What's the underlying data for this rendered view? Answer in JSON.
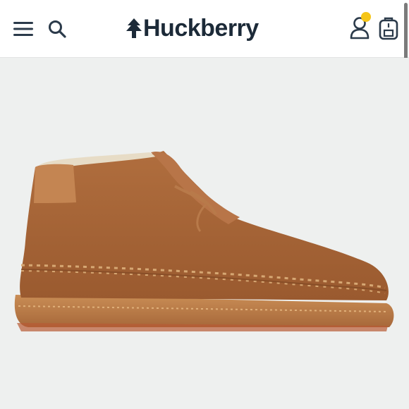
{
  "header": {
    "logo_text": "Huckberry",
    "menu_icon": "hamburger-menu-icon",
    "search_icon": "search-icon",
    "account_icon": "account-icon",
    "cart_icon": "backpack-cart-icon",
    "notification_badge_color": "#f5c518"
  },
  "product": {
    "image_subject": "suede-chukka-sneaker-boot",
    "background_color": "#eef0ef",
    "primary_color": "#a5663a"
  },
  "colors": {
    "brand_text": "#1c2a38",
    "icon_stroke": "#2b3a4a",
    "header_bg": "#ffffff"
  }
}
